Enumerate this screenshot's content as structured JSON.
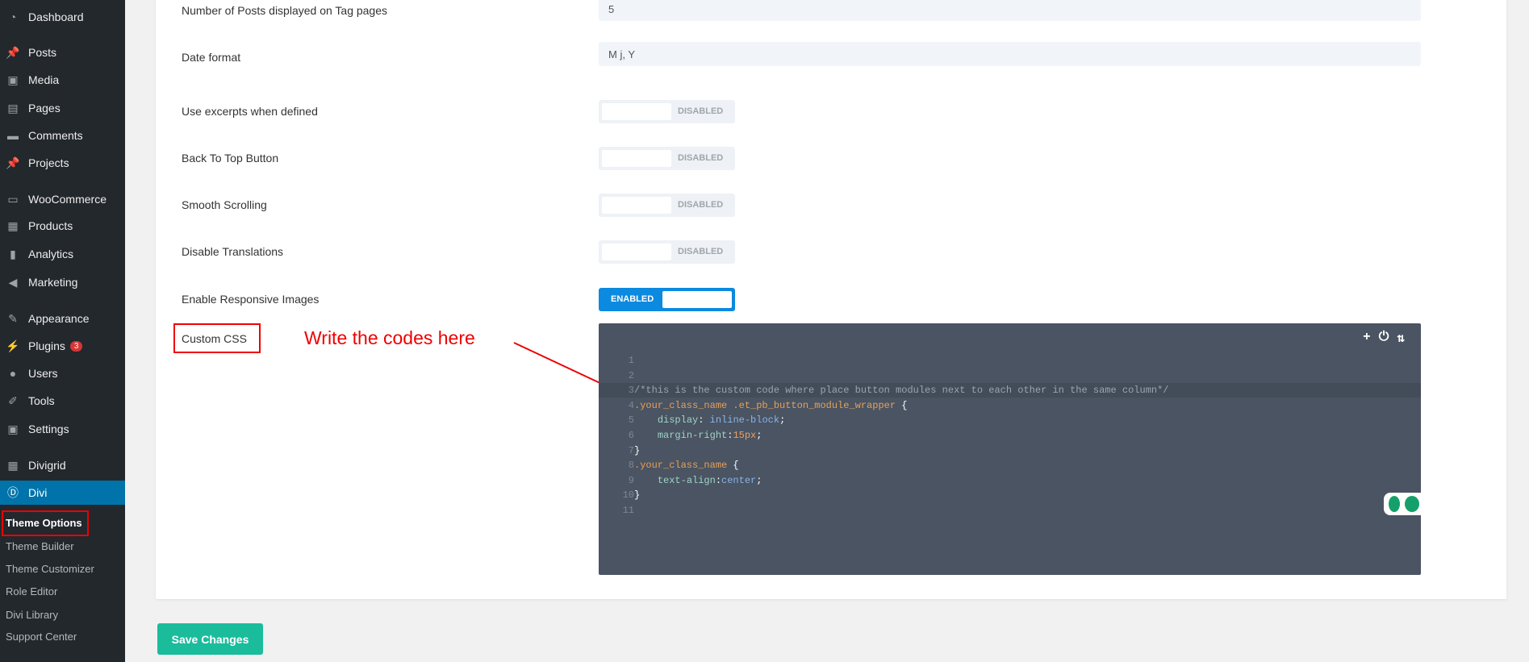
{
  "sidebar": {
    "items": [
      {
        "label": "Dashboard",
        "icon": "dashboard-icon"
      },
      {
        "label": "Posts",
        "icon": "pin-icon"
      },
      {
        "label": "Media",
        "icon": "media-icon"
      },
      {
        "label": "Pages",
        "icon": "pages-icon"
      },
      {
        "label": "Comments",
        "icon": "comment-icon"
      },
      {
        "label": "Projects",
        "icon": "pin-icon"
      },
      {
        "label": "WooCommerce",
        "icon": "woo-icon"
      },
      {
        "label": "Products",
        "icon": "products-icon"
      },
      {
        "label": "Analytics",
        "icon": "analytics-icon"
      },
      {
        "label": "Marketing",
        "icon": "megaphone-icon"
      },
      {
        "label": "Appearance",
        "icon": "brush-icon"
      },
      {
        "label": "Plugins",
        "icon": "plugin-icon",
        "badge": "3"
      },
      {
        "label": "Users",
        "icon": "user-icon"
      },
      {
        "label": "Tools",
        "icon": "wrench-icon"
      },
      {
        "label": "Settings",
        "icon": "settings-icon"
      },
      {
        "label": "Divigrid",
        "icon": "grid-icon"
      },
      {
        "label": "Divi",
        "icon": "divi-icon",
        "active": true
      }
    ],
    "submenu": [
      "Theme Options",
      "Theme Builder",
      "Theme Customizer",
      "Role Editor",
      "Divi Library",
      "Support Center"
    ]
  },
  "settings": {
    "tag_posts": {
      "label": "Number of Posts displayed on Tag pages",
      "value": "5"
    },
    "date_format": {
      "label": "Date format",
      "value": "M j, Y"
    },
    "toggles": [
      {
        "label": "Use excerpts when defined",
        "state": "DISABLED"
      },
      {
        "label": "Back To Top Button",
        "state": "DISABLED"
      },
      {
        "label": "Smooth Scrolling",
        "state": "DISABLED"
      },
      {
        "label": "Disable Translations",
        "state": "DISABLED"
      },
      {
        "label": "Enable Responsive Images",
        "state": "ENABLED"
      }
    ],
    "custom_css_label": "Custom CSS"
  },
  "annotation": "Write the codes here",
  "editor": {
    "tools": [
      "+",
      "⏻",
      "⇅"
    ],
    "lines": [
      "",
      "",
      "/*this is the custom code where place button modules next to each other in the same column*/",
      ".your_class_name .et_pb_button_module_wrapper {",
      "    display: inline-block;",
      "    margin-right:15px;",
      "}",
      ".your_class_name {",
      "    text-align:center;",
      "}",
      ""
    ]
  },
  "save_label": "Save Changes",
  "colors": {
    "accent": "#0073aa",
    "save": "#1abc9c",
    "annotation": "#ee0000"
  }
}
